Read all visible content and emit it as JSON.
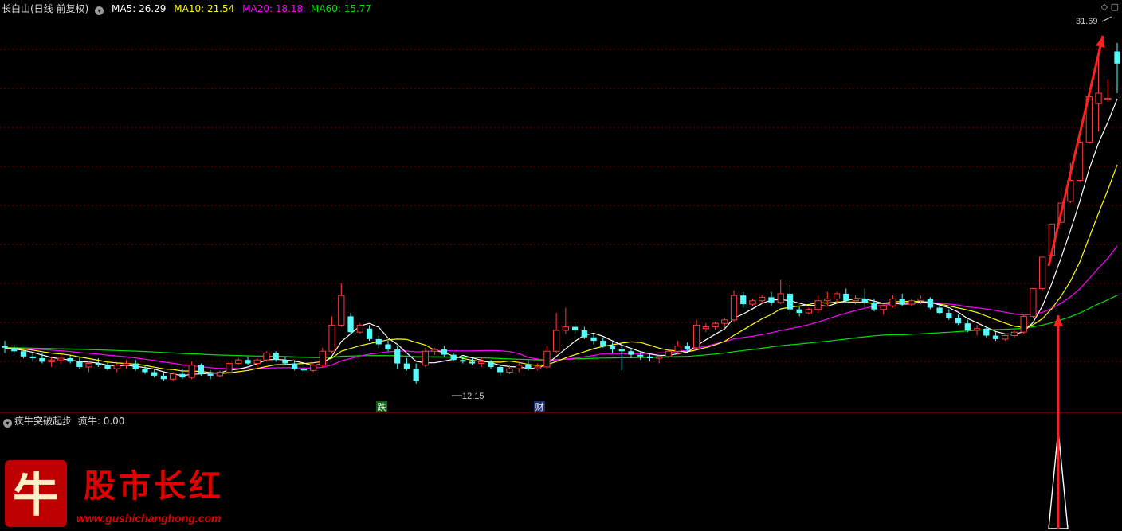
{
  "header": {
    "title": "长白山(日线 前复权)",
    "ma5": "MA5: 26.29",
    "ma10": "MA10: 21.54",
    "ma20": "MA20: 18.18",
    "ma60": "MA60: 15.77"
  },
  "indicator": {
    "name": "疯牛突破起步",
    "value": "疯牛: 0.00"
  },
  "annotations": {
    "high": "31.69",
    "low": "12.15",
    "mark1": "跌",
    "mark2": "财"
  },
  "watermark": {
    "logo_char": "牛",
    "brand": "股市长红",
    "url": "www.gushichanghong.com"
  },
  "colors": {
    "background": "#000000",
    "up": "#ff3b3b",
    "down": "#54fcfc",
    "ma5": "#ffffff",
    "ma10": "#ffff00",
    "ma20": "#ff00ff",
    "ma60": "#00e000",
    "grid": "#7a0000"
  },
  "chart_data": {
    "type": "candlestick",
    "title": "长白山(日线 前复权)",
    "price_range": [
      11.5,
      32.5
    ],
    "candles_ohlc": [
      [
        14.3,
        14.6,
        13.9,
        14.2
      ],
      [
        14.2,
        14.4,
        13.9,
        14.0
      ],
      [
        14.0,
        14.1,
        13.6,
        13.7
      ],
      [
        13.7,
        13.9,
        13.4,
        13.6
      ],
      [
        13.6,
        13.9,
        13.3,
        13.4
      ],
      [
        13.4,
        13.7,
        13.1,
        13.5
      ],
      [
        13.5,
        13.8,
        13.3,
        13.6
      ],
      [
        13.6,
        13.8,
        13.3,
        13.4
      ],
      [
        13.4,
        13.7,
        13.0,
        13.1
      ],
      [
        13.1,
        13.4,
        12.8,
        13.3
      ],
      [
        13.3,
        13.6,
        13.1,
        13.2
      ],
      [
        13.2,
        13.4,
        12.9,
        13.0
      ],
      [
        13.0,
        13.3,
        12.8,
        13.2
      ],
      [
        13.2,
        13.5,
        13.0,
        13.3
      ],
      [
        13.3,
        13.5,
        12.9,
        13.0
      ],
      [
        13.0,
        13.2,
        12.7,
        12.8
      ],
      [
        12.8,
        13.0,
        12.5,
        12.6
      ],
      [
        12.6,
        12.8,
        12.3,
        12.4
      ],
      [
        12.4,
        12.8,
        12.3,
        12.7
      ],
      [
        12.7,
        13.0,
        12.4,
        12.5
      ],
      [
        12.5,
        13.4,
        12.4,
        13.2
      ],
      [
        13.2,
        13.3,
        12.6,
        12.7
      ],
      [
        12.7,
        12.9,
        12.4,
        12.6
      ],
      [
        12.6,
        12.9,
        12.5,
        12.8
      ],
      [
        12.8,
        13.4,
        12.7,
        13.3
      ],
      [
        13.3,
        13.6,
        13.2,
        13.5
      ],
      [
        13.5,
        13.7,
        13.2,
        13.3
      ],
      [
        13.3,
        13.6,
        13.1,
        13.5
      ],
      [
        13.5,
        14.0,
        13.4,
        13.9
      ],
      [
        13.9,
        14.0,
        13.4,
        13.5
      ],
      [
        13.5,
        13.7,
        13.2,
        13.3
      ],
      [
        13.3,
        13.5,
        12.9,
        13.0
      ],
      [
        13.0,
        13.2,
        12.8,
        12.9
      ],
      [
        12.9,
        13.3,
        12.8,
        13.2
      ],
      [
        13.2,
        14.2,
        13.1,
        14.0
      ],
      [
        14.0,
        16.0,
        13.9,
        15.5
      ],
      [
        15.5,
        17.9,
        15.4,
        17.2
      ],
      [
        16.0,
        16.2,
        15.0,
        15.1
      ],
      [
        15.1,
        15.6,
        15.0,
        15.5
      ],
      [
        15.3,
        15.5,
        14.6,
        14.7
      ],
      [
        14.7,
        14.9,
        14.2,
        14.4
      ],
      [
        14.4,
        14.6,
        14.0,
        14.1
      ],
      [
        14.1,
        14.3,
        13.0,
        13.3
      ],
      [
        13.3,
        13.6,
        12.9,
        13.0
      ],
      [
        13.0,
        13.3,
        12.15,
        12.3
      ],
      [
        13.2,
        14.2,
        13.1,
        14.0
      ],
      [
        14.0,
        14.2,
        13.8,
        14.1
      ],
      [
        14.1,
        14.3,
        13.7,
        13.8
      ],
      [
        13.8,
        13.9,
        13.4,
        13.5
      ],
      [
        13.5,
        13.7,
        13.3,
        13.4
      ],
      [
        13.4,
        13.6,
        13.2,
        13.3
      ],
      [
        13.3,
        13.6,
        13.1,
        13.4
      ],
      [
        13.4,
        13.5,
        13.0,
        13.1
      ],
      [
        13.1,
        13.2,
        12.6,
        12.8
      ],
      [
        12.8,
        13.2,
        12.7,
        13.0
      ],
      [
        13.0,
        13.4,
        12.8,
        13.2
      ],
      [
        13.2,
        13.5,
        12.9,
        13.0
      ],
      [
        13.0,
        13.3,
        12.9,
        13.1
      ],
      [
        13.1,
        14.3,
        13.0,
        14.0
      ],
      [
        14.0,
        16.2,
        13.9,
        15.2
      ],
      [
        15.2,
        16.5,
        15.0,
        15.4
      ],
      [
        15.4,
        15.7,
        15.0,
        15.2
      ],
      [
        15.2,
        15.4,
        14.7,
        14.8
      ],
      [
        14.8,
        15.0,
        14.4,
        14.6
      ],
      [
        14.6,
        14.8,
        14.2,
        14.3
      ],
      [
        14.3,
        14.5,
        13.9,
        14.1
      ],
      [
        14.1,
        14.3,
        12.9,
        14.0
      ],
      [
        14.0,
        14.2,
        13.6,
        13.8
      ],
      [
        13.8,
        14.0,
        13.5,
        13.7
      ],
      [
        13.7,
        13.9,
        13.4,
        13.6
      ],
      [
        13.6,
        13.8,
        13.3,
        13.7
      ],
      [
        13.7,
        14.0,
        13.6,
        14.0
      ],
      [
        14.0,
        14.6,
        13.8,
        14.3
      ],
      [
        14.3,
        14.5,
        14.0,
        14.1
      ],
      [
        14.2,
        15.8,
        14.1,
        15.5
      ],
      [
        15.3,
        15.6,
        15.1,
        15.4
      ],
      [
        15.4,
        15.7,
        15.2,
        15.6
      ],
      [
        15.6,
        15.9,
        15.3,
        15.8
      ],
      [
        15.8,
        17.5,
        15.7,
        17.2
      ],
      [
        17.2,
        17.4,
        16.5,
        16.7
      ],
      [
        16.7,
        17.0,
        16.6,
        16.9
      ],
      [
        16.9,
        17.2,
        16.7,
        17.1
      ],
      [
        17.1,
        17.4,
        16.6,
        16.8
      ],
      [
        16.8,
        18.1,
        16.7,
        17.3
      ],
      [
        17.3,
        17.8,
        16.1,
        16.4
      ],
      [
        16.4,
        16.6,
        16.0,
        16.2
      ],
      [
        16.2,
        16.5,
        16.1,
        16.4
      ],
      [
        16.4,
        17.2,
        16.2,
        16.9
      ],
      [
        16.9,
        17.4,
        16.6,
        17.0
      ],
      [
        17.0,
        17.4,
        16.7,
        17.3
      ],
      [
        17.3,
        17.6,
        16.8,
        16.9
      ],
      [
        16.9,
        17.2,
        16.7,
        17.0
      ],
      [
        17.0,
        17.6,
        16.5,
        16.8
      ],
      [
        16.8,
        17.0,
        16.3,
        16.4
      ],
      [
        16.4,
        16.7,
        16.1,
        16.6
      ],
      [
        16.6,
        17.2,
        16.5,
        17.0
      ],
      [
        17.0,
        17.3,
        16.6,
        16.7
      ],
      [
        16.7,
        17.0,
        16.6,
        16.9
      ],
      [
        16.9,
        17.2,
        16.7,
        17.0
      ],
      [
        17.0,
        17.1,
        16.4,
        16.5
      ],
      [
        16.5,
        16.7,
        16.1,
        16.2
      ],
      [
        16.2,
        16.4,
        15.8,
        15.9
      ],
      [
        15.9,
        16.1,
        15.5,
        15.6
      ],
      [
        15.6,
        15.8,
        15.1,
        15.2
      ],
      [
        15.2,
        15.5,
        14.9,
        15.3
      ],
      [
        15.3,
        15.4,
        14.8,
        14.9
      ],
      [
        14.9,
        15.1,
        14.6,
        14.7
      ],
      [
        14.7,
        15.0,
        14.6,
        14.9
      ],
      [
        14.9,
        15.2,
        14.8,
        15.1
      ],
      [
        15.1,
        16.1,
        15.0,
        16.0
      ],
      [
        16.0,
        17.6,
        15.9,
        17.6
      ],
      [
        17.6,
        19.4,
        17.5,
        19.4
      ],
      [
        19.5,
        21.3,
        19.4,
        21.3
      ],
      [
        21.4,
        23.4,
        21.2,
        22.5
      ],
      [
        22.6,
        24.8,
        22.5,
        23.8
      ],
      [
        23.8,
        26.1,
        23.7,
        26.0
      ],
      [
        26.0,
        28.6,
        25.9,
        28.6
      ],
      [
        28.2,
        31.0,
        26.6,
        28.8
      ],
      [
        28.5,
        29.6,
        28.3,
        28.5
      ],
      [
        31.2,
        31.69,
        28.8,
        30.5
      ]
    ],
    "ma5": [
      26.29
    ],
    "ma10": [
      21.54
    ],
    "ma20": [
      18.18
    ],
    "ma60": [
      15.77
    ],
    "annotations": [
      "31.69",
      "12.15",
      "跌",
      "财"
    ]
  }
}
